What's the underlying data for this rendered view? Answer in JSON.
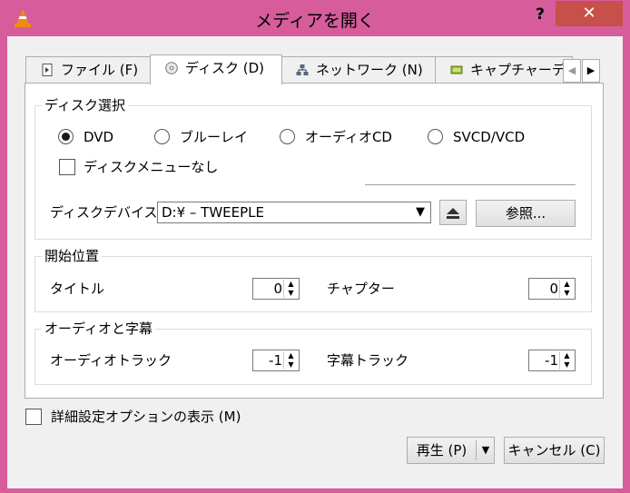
{
  "window": {
    "title": "メディアを開く",
    "help_label": "?",
    "close_label": "✕"
  },
  "tabs": [
    {
      "label": "ファイル (F)",
      "icon": "file-icon",
      "active": false
    },
    {
      "label": "ディスク (D)",
      "icon": "disc-icon",
      "active": true
    },
    {
      "label": "ネットワーク (N)",
      "icon": "network-icon",
      "active": false
    },
    {
      "label": "キャプチャーデ",
      "icon": "capture-icon",
      "active": false
    }
  ],
  "disc_selection": {
    "group_label": "ディスク選択",
    "options": [
      {
        "label": "DVD",
        "selected": true
      },
      {
        "label": "ブルーレイ",
        "selected": false
      },
      {
        "label": "オーディオCD",
        "selected": false
      },
      {
        "label": "SVCD/VCD",
        "selected": false
      }
    ],
    "no_menu_label": "ディスクメニューなし",
    "no_menu_checked": false,
    "device_label": "ディスクデバイス",
    "device_value": "D:¥ – TWEEPLE",
    "browse_label": "参照..."
  },
  "start_position": {
    "group_label": "開始位置",
    "title_label": "タイトル",
    "title_value": "0",
    "chapter_label": "チャプター",
    "chapter_value": "0"
  },
  "audio_subtitles": {
    "group_label": "オーディオと字幕",
    "audio_track_label": "オーディオトラック",
    "audio_track_value": "-1",
    "subtitle_track_label": "字幕トラック",
    "subtitle_track_value": "-1"
  },
  "footer": {
    "advanced_label": "詳細設定オプションの表示 (M)",
    "advanced_checked": false,
    "play_label": "再生 (P)",
    "cancel_label": "キャンセル (C)"
  },
  "colors": {
    "frame": "#d65c9c",
    "close_button": "#c7504a"
  }
}
